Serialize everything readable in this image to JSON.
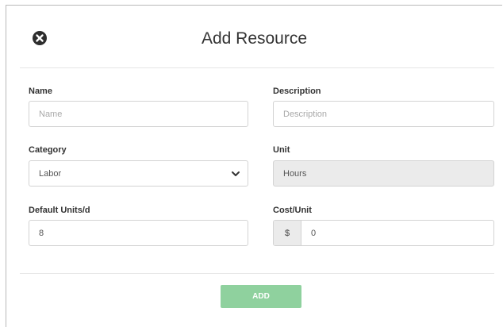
{
  "modal": {
    "title": "Add Resource",
    "close_icon": "close-circle-icon"
  },
  "form": {
    "name": {
      "label": "Name",
      "placeholder": "Name"
    },
    "description": {
      "label": "Description",
      "placeholder": "Description"
    },
    "category": {
      "label": "Category",
      "value": "Labor",
      "icon": "chevron-down-icon"
    },
    "unit": {
      "label": "Unit",
      "value": "Hours"
    },
    "default_units": {
      "label": "Default Units/d",
      "value": "8"
    },
    "cost_unit": {
      "label": "Cost/Unit",
      "currency_symbol": "$",
      "value": "0"
    }
  },
  "footer": {
    "add_label": "ADD"
  },
  "colors": {
    "add_button": "#8fd19e",
    "readonly_bg": "#ebebeb"
  }
}
